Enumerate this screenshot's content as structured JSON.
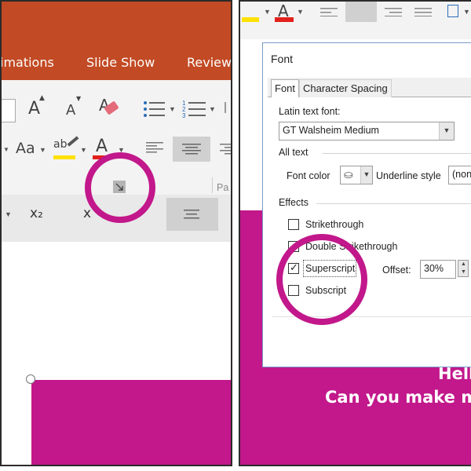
{
  "left_window": {
    "tabs": [
      "imations",
      "Slide Show",
      "Review"
    ],
    "ribbon": {
      "increase_font_glyph": "A",
      "decrease_font_glyph": "A",
      "clear_format_glyph": "A",
      "change_case_glyph": "Aa",
      "highlight_glyph": "ab",
      "font_color_glyph": "A",
      "numbered_list_glyph": "1 2 3",
      "subscript_glyph": "x₂",
      "x_glyph": "x",
      "group_label": "Pa"
    },
    "colors": {
      "title_bar": "#c24a24",
      "accent_circle": "#c2188b",
      "slide_fill": "#c2188b",
      "highlight_yellow": "#ffe100",
      "font_red": "#e3201b"
    }
  },
  "font_dialog": {
    "title": "Font",
    "tabs": [
      "Font",
      "Character Spacing"
    ],
    "latin_font_label": "Latin text font:",
    "latin_font_value": "GT Walsheim Medium",
    "all_text_label": "All text",
    "font_color_label": "Font color",
    "underline_style_label": "Underline style",
    "underline_style_value": "(non",
    "effects_label": "Effects",
    "effects": [
      {
        "label": "Strikethrough",
        "checked": false
      },
      {
        "label": "Double Strikethrough",
        "checked": false
      },
      {
        "label": "Superscript",
        "checked": true
      },
      {
        "label": "Subscript",
        "checked": false
      }
    ],
    "offset_label": "Offset:",
    "offset_value": "30%"
  },
  "slide_text": {
    "line1": "Hell",
    "line2": "Can you make m"
  }
}
